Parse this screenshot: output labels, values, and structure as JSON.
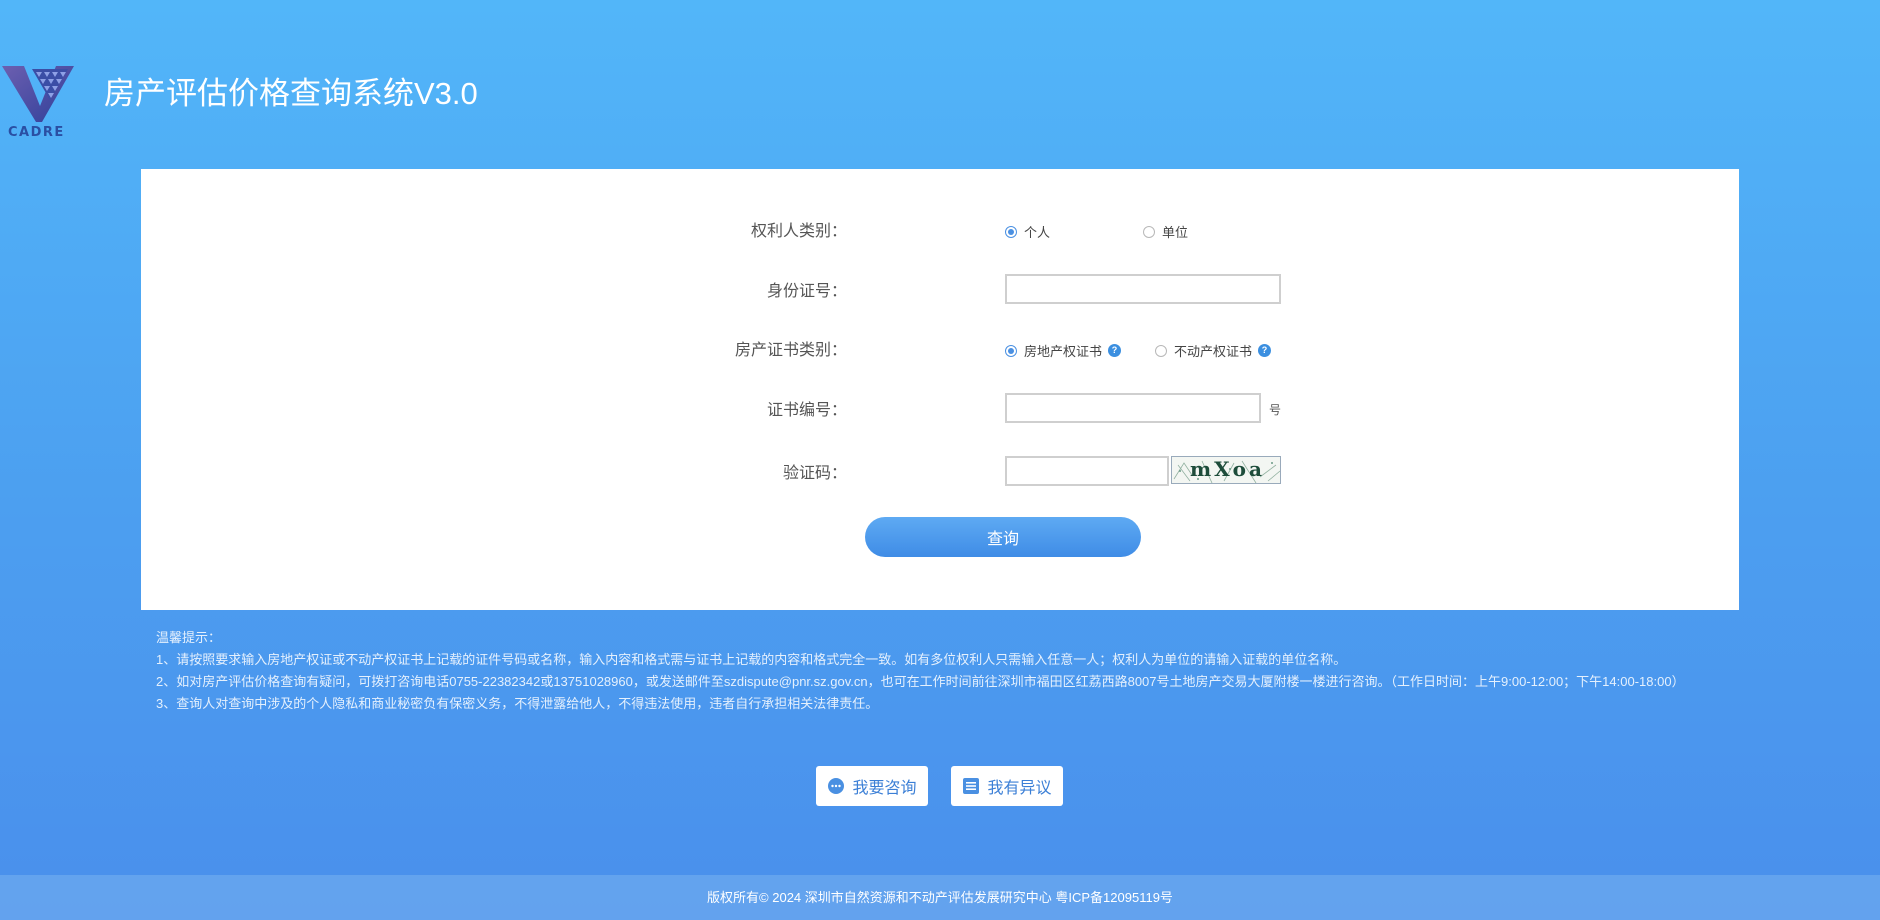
{
  "header": {
    "logo_text": "CADRE",
    "title": "房产评估价格查询系统V3.0"
  },
  "form": {
    "holder_type": {
      "label": "权利人类别：",
      "options": [
        "个人",
        "单位"
      ],
      "selected": "个人"
    },
    "id_number": {
      "label": "身份证号：",
      "value": "",
      "placeholder": ""
    },
    "cert_type": {
      "label": "房产证书类别：",
      "options": [
        "房地产权证书",
        "不动产权证书"
      ],
      "selected": "房地产权证书"
    },
    "cert_number": {
      "label": "证书编号：",
      "value": "",
      "placeholder": "",
      "suffix": "号"
    },
    "captcha": {
      "label": "验证码：",
      "value": "",
      "placeholder": "",
      "image_text": "mXoa"
    },
    "submit_label": "查询"
  },
  "tips": {
    "title": "温馨提示：",
    "items": [
      "1、请按照要求输入房地产权证或不动产权证书上记载的证件号码或名称，输入内容和格式需与证书上记载的内容和格式完全一致。如有多位权利人只需输入任意一人；权利人为单位的请输入证载的单位名称。",
      "2、如对房产评估价格查询有疑问，可拨打咨询电话0755-22382342或13751028960，或发送邮件至szdispute@pnr.sz.gov.cn，也可在工作时间前往深圳市福田区红荔西路8007号土地房产交易大厦附楼一楼进行咨询。（工作日时间：上午9:00-12:00；下午14:00-18:00）",
      "3、查询人对查询中涉及的个人隐私和商业秘密负有保密义务，不得泄露给他人，不得违法使用，违者自行承担相关法律责任。"
    ]
  },
  "actions": {
    "consult_label": "我要咨询",
    "objection_label": "我有异议"
  },
  "footer": {
    "text": "版权所有© 2024 深圳市自然资源和不动产评估发展研究中心 粤ICP备12095119号"
  },
  "colors": {
    "primary": "#4a90e2",
    "background": "#4c9ff0",
    "logo": "#2a4fa3"
  },
  "icons": {
    "consult": "chat-bubble-icon",
    "objection": "document-list-icon",
    "help": "question-circle-icon"
  }
}
